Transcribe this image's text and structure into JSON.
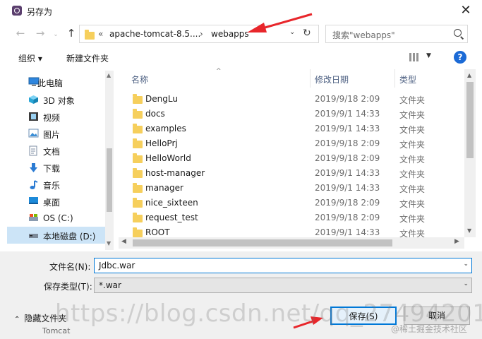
{
  "window": {
    "title": "另存为"
  },
  "nav": {
    "address_segments": [
      "apache-tomcat-8.5....",
      "webapps"
    ],
    "address_prefix": "«",
    "search_placeholder": "搜索\"webapps\""
  },
  "toolbar": {
    "organize": "组织 ▾",
    "new_folder": "新建文件夹"
  },
  "sidebar": {
    "items": [
      {
        "label": "此电脑",
        "icon": "computer-icon"
      },
      {
        "label": "3D 对象",
        "icon": "cube-icon"
      },
      {
        "label": "视频",
        "icon": "video-icon"
      },
      {
        "label": "图片",
        "icon": "picture-icon"
      },
      {
        "label": "文档",
        "icon": "document-icon"
      },
      {
        "label": "下载",
        "icon": "download-icon"
      },
      {
        "label": "音乐",
        "icon": "music-icon"
      },
      {
        "label": "桌面",
        "icon": "desktop-icon"
      },
      {
        "label": "OS (C:)",
        "icon": "drive-icon"
      },
      {
        "label": "本地磁盘 (D:)",
        "icon": "drive-icon",
        "selected": true
      }
    ]
  },
  "columns": {
    "name": "名称",
    "date": "修改日期",
    "type": "类型"
  },
  "files": [
    {
      "name": "DengLu",
      "date": "2019/9/18 2:09",
      "type": "文件夹"
    },
    {
      "name": "docs",
      "date": "2019/9/1 14:33",
      "type": "文件夹"
    },
    {
      "name": "examples",
      "date": "2019/9/1 14:33",
      "type": "文件夹"
    },
    {
      "name": "HelloPrj",
      "date": "2019/9/18 2:09",
      "type": "文件夹"
    },
    {
      "name": "HelloWorld",
      "date": "2019/9/18 2:09",
      "type": "文件夹"
    },
    {
      "name": "host-manager",
      "date": "2019/9/1 14:33",
      "type": "文件夹"
    },
    {
      "name": "manager",
      "date": "2019/9/1 14:33",
      "type": "文件夹"
    },
    {
      "name": "nice_sixteen",
      "date": "2019/9/18 2:09",
      "type": "文件夹"
    },
    {
      "name": "request_test",
      "date": "2019/9/18 2:09",
      "type": "文件夹"
    },
    {
      "name": "ROOT",
      "date": "2019/9/1 14:33",
      "type": "文件夹"
    }
  ],
  "form": {
    "filename_label": "文件名(N):",
    "filename_value": "Jdbc.war",
    "filetype_label": "保存类型(T):",
    "filetype_value": "*.war"
  },
  "footer": {
    "hide_folders": "隐藏文件夹",
    "save": "保存(S)",
    "cancel": "取消"
  },
  "background": {
    "tomcat_label": "Tomcat"
  },
  "watermarks": {
    "csdn": "https://blog.csdn.net/qq_27494201",
    "juejin": "@稀土掘金技术社区"
  },
  "colors": {
    "accent": "#0078d7",
    "annotation": "#e8262b",
    "folder": "#f6cf5c"
  }
}
